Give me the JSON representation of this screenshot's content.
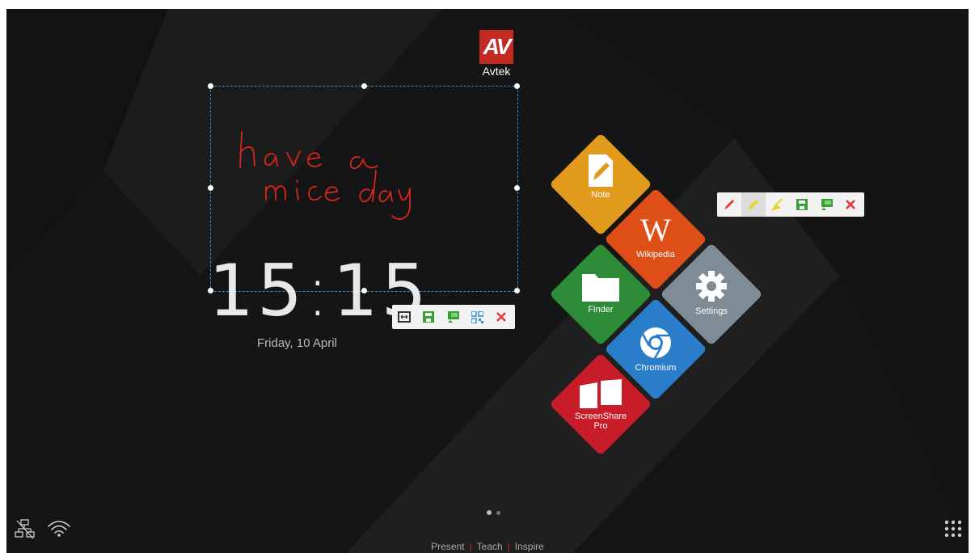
{
  "brand": {
    "mark": "AV",
    "name": "Avtek"
  },
  "note": {
    "handwriting_line1": "have a",
    "handwriting_line2": "mice day"
  },
  "clock": {
    "time_hours": "15",
    "time_minutes": "15",
    "date": "Friday, 10 April"
  },
  "selection_toolbar": {
    "buttons": [
      {
        "icon": "fullscreen-icon",
        "color": "#333333"
      },
      {
        "icon": "save-icon",
        "color": "#39a035"
      },
      {
        "icon": "presentation-icon",
        "color": "#39a035"
      },
      {
        "icon": "qr-code-icon",
        "color": "#2e8fd6"
      },
      {
        "icon": "close-icon",
        "color": "#e53935"
      }
    ]
  },
  "pen_toolbar": {
    "buttons": [
      {
        "icon": "pen-icon",
        "color": "#e53935"
      },
      {
        "icon": "highlighter-icon",
        "color": "#e8d52a"
      },
      {
        "icon": "eraser-icon",
        "color": "#e8d52a"
      },
      {
        "icon": "save-icon",
        "color": "#39a035"
      },
      {
        "icon": "presentation-icon",
        "color": "#39a035"
      },
      {
        "icon": "close-icon",
        "color": "#e53935"
      }
    ]
  },
  "tiles": [
    {
      "id": "note",
      "label": "Note",
      "color": "#e29a1c"
    },
    {
      "id": "wikipedia",
      "label": "Wikipedia",
      "color": "#dd4f17"
    },
    {
      "id": "finder",
      "label": "Finder",
      "color": "#2e8b37"
    },
    {
      "id": "settings",
      "label": "Settings",
      "color": "#7f8b95"
    },
    {
      "id": "chromium",
      "label": "Chromium",
      "color": "#2a7dc8"
    },
    {
      "id": "screenshare",
      "label_line1": "ScreenShare",
      "label_line2": "Pro",
      "color": "#c91c29"
    }
  ],
  "pager": {
    "pages": 2,
    "current": 1
  },
  "footer": {
    "word1": "Present",
    "separator": "|",
    "word2": "Teach",
    "word3": "Inspire"
  },
  "colors": {
    "accent": "#c32a22",
    "selection": "#2e8fd6",
    "ink": "#d7271f"
  }
}
